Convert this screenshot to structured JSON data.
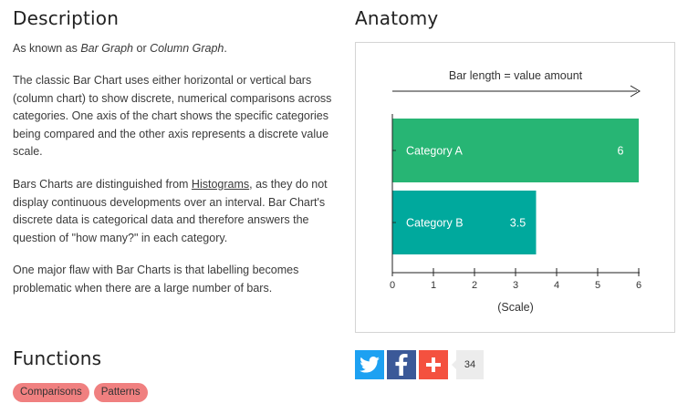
{
  "description": {
    "title": "Description",
    "p1_pre": "As known as ",
    "p1_alias1": "Bar Graph",
    "p1_mid": " or ",
    "p1_alias2": "Column Graph",
    "p1_post": ".",
    "p2": "The classic Bar Chart uses either horizontal or vertical bars (column chart) to show discrete, numerical comparisons across categories. One axis of the chart shows the specific categories being compared and the other axis represents a discrete value scale.",
    "p3_pre": "Bars Charts are distinguished from ",
    "p3_link": "Histograms",
    "p3_post": ", as they do not display continuous developments over an interval. Bar Chart's discrete data is categorical data and therefore answers the question of \"how many?\" in each category.",
    "p4": "One major flaw with Bar Charts is that labelling becomes problematic when there are a large number of bars."
  },
  "anatomy": {
    "title": "Anatomy"
  },
  "chart_data": {
    "type": "bar",
    "orientation": "horizontal",
    "annotation": "Bar length  =  value amount",
    "xlabel": "(Scale)",
    "ylabel": "",
    "xlim": [
      0,
      6
    ],
    "xticks": [
      0,
      1,
      2,
      3,
      4,
      5,
      6
    ],
    "categories": [
      "Category A",
      "Category B"
    ],
    "values": [
      6,
      3.5
    ],
    "value_labels": [
      "6",
      "3.5"
    ],
    "colors": [
      "#27b574",
      "#00a99d"
    ]
  },
  "functions": {
    "title": "Functions",
    "tags": [
      "Comparisons",
      "Patterns"
    ]
  },
  "share": {
    "twitter_icon": "twitter-icon",
    "facebook_icon": "facebook-icon",
    "plus_icon": "plus-icon",
    "twitter_color": "#1da1f2",
    "facebook_color": "#3b5998",
    "plus_color": "#f4513f",
    "count": "34"
  }
}
